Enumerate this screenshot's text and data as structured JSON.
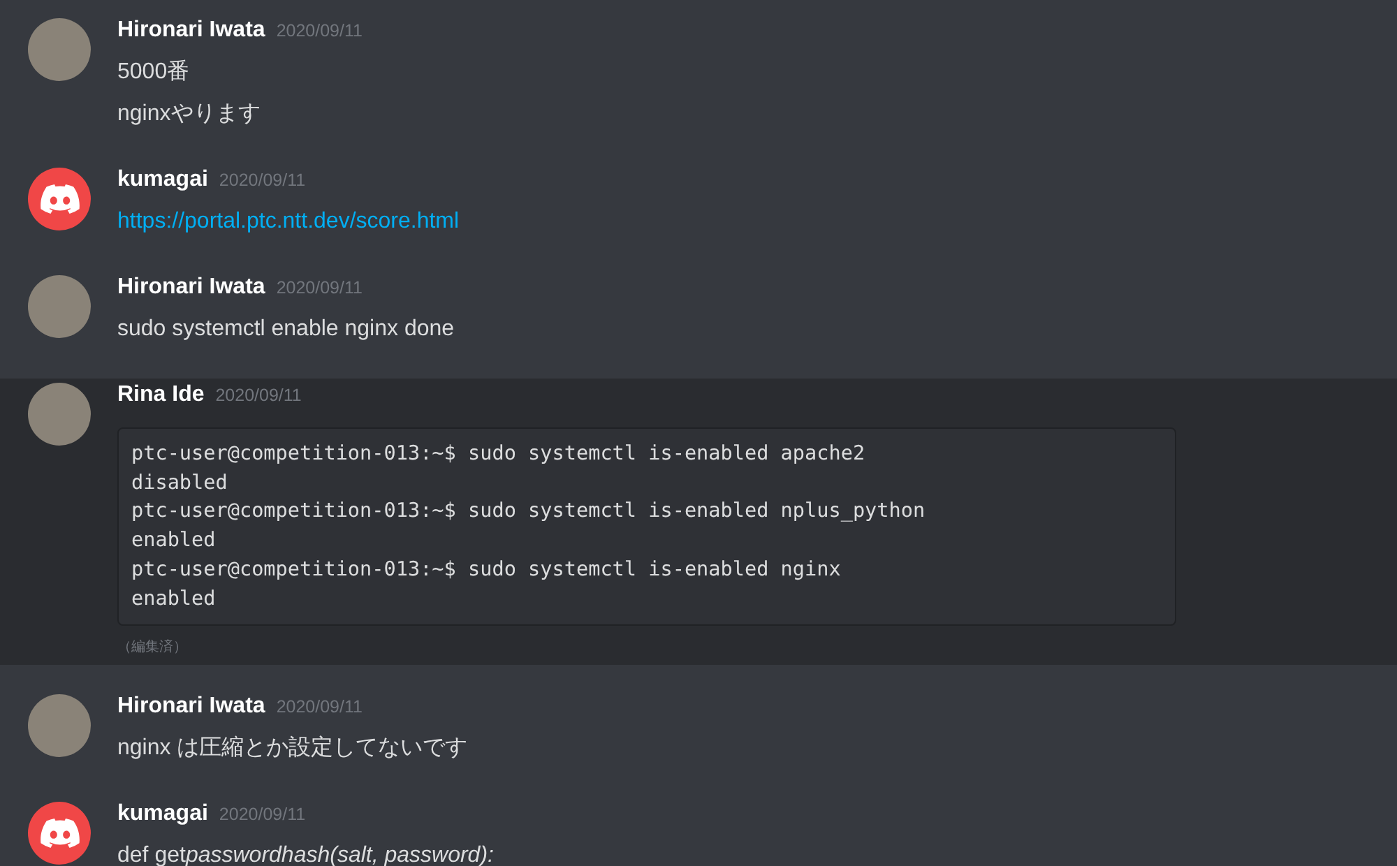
{
  "messages": [
    {
      "author": "Hironari Iwata",
      "timestamp": "2020/09/11",
      "kind": "photo",
      "highlighted": false,
      "lines": [
        {
          "kind": "text",
          "text": "5000番"
        },
        {
          "kind": "text",
          "text": "nginxやります"
        }
      ]
    },
    {
      "author": "kumagai",
      "timestamp": "2020/09/11",
      "kind": "logo",
      "highlighted": false,
      "lines": [
        {
          "kind": "link",
          "text": "https://portal.ptc.ntt.dev/score.html"
        }
      ]
    },
    {
      "author": "Hironari Iwata",
      "timestamp": "2020/09/11",
      "kind": "photo",
      "highlighted": false,
      "lines": [
        {
          "kind": "text",
          "text": "sudo systemctl enable nginx done"
        }
      ]
    },
    {
      "author": "Rina Ide",
      "timestamp": "2020/09/11",
      "kind": "photo",
      "highlighted": true,
      "lines": [
        {
          "kind": "code",
          "text": [
            "ptc-user@competition-013:~$ sudo systemctl is-enabled apache2",
            "disabled",
            "ptc-user@competition-013:~$ sudo systemctl is-enabled nplus_python",
            "enabled",
            "ptc-user@competition-013:~$ sudo systemctl is-enabled nginx",
            "enabled"
          ]
        },
        {
          "kind": "edited",
          "text": "（編集済）"
        }
      ]
    },
    {
      "author": "Hironari Iwata",
      "timestamp": "2020/09/11",
      "kind": "photo",
      "highlighted": false,
      "lines": [
        {
          "kind": "text",
          "text": "nginx は圧縮とか設定してないです"
        }
      ]
    },
    {
      "author": "kumagai",
      "timestamp": "2020/09/11",
      "kind": "logo",
      "highlighted": false,
      "lines": [
        {
          "kind": "text",
          "text": "def get",
          "italic_part": "passwordhash(salt, password):"
        }
      ]
    }
  ]
}
